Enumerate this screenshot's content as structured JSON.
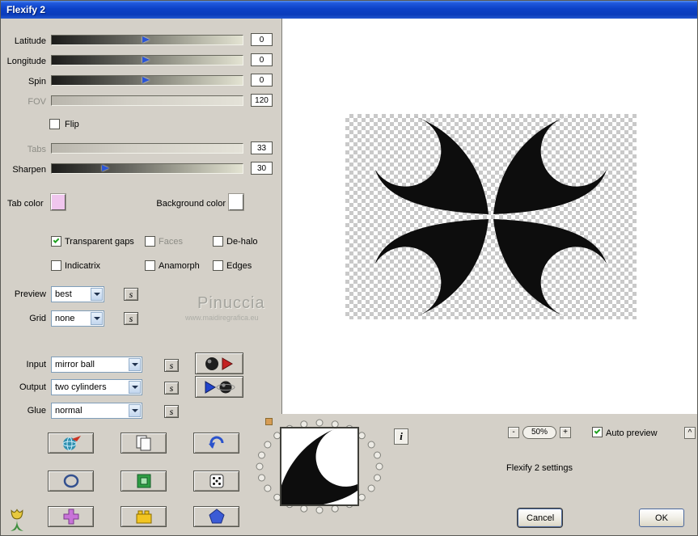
{
  "window": {
    "title": "Flexify 2"
  },
  "sliders": {
    "latitude": {
      "label": "Latitude",
      "value": "0"
    },
    "longitude": {
      "label": "Longitude",
      "value": "0"
    },
    "spin": {
      "label": "Spin",
      "value": "0"
    },
    "fov": {
      "label": "FOV",
      "value": "120"
    },
    "tabs": {
      "label": "Tabs",
      "value": "33"
    },
    "sharpen": {
      "label": "Sharpen",
      "value": "30"
    }
  },
  "checkboxes": {
    "flip": "Flip",
    "transparent_gaps": "Transparent gaps",
    "faces": "Faces",
    "de_halo": "De-halo",
    "indicatrix": "Indicatrix",
    "anamorph": "Anamorph",
    "edges": "Edges",
    "auto_preview": "Auto preview"
  },
  "color_pickers": {
    "tab_color_label": "Tab color",
    "tab_color": "#f0c6ee",
    "background_color_label": "Background color",
    "background_color": "#ffffff"
  },
  "dropdowns": {
    "preview_label": "Preview",
    "preview_value": "best",
    "grid_label": "Grid",
    "grid_value": "none",
    "input_label": "Input",
    "input_value": "mirror ball",
    "output_label": "Output",
    "output_value": "two cylinders",
    "glue_label": "Glue",
    "glue_value": "normal"
  },
  "buttons": {
    "save_settings": "s",
    "info": "i",
    "zoom_out": "-",
    "zoom_in": "+",
    "collapse": "^",
    "cancel": "Cancel",
    "ok": "OK"
  },
  "zoom": {
    "level": "50%"
  },
  "footer": {
    "settings_text": "Flexify 2 settings"
  },
  "watermark": {
    "name": "Pinuccia",
    "url": "www.maidiregrafica.eu"
  }
}
